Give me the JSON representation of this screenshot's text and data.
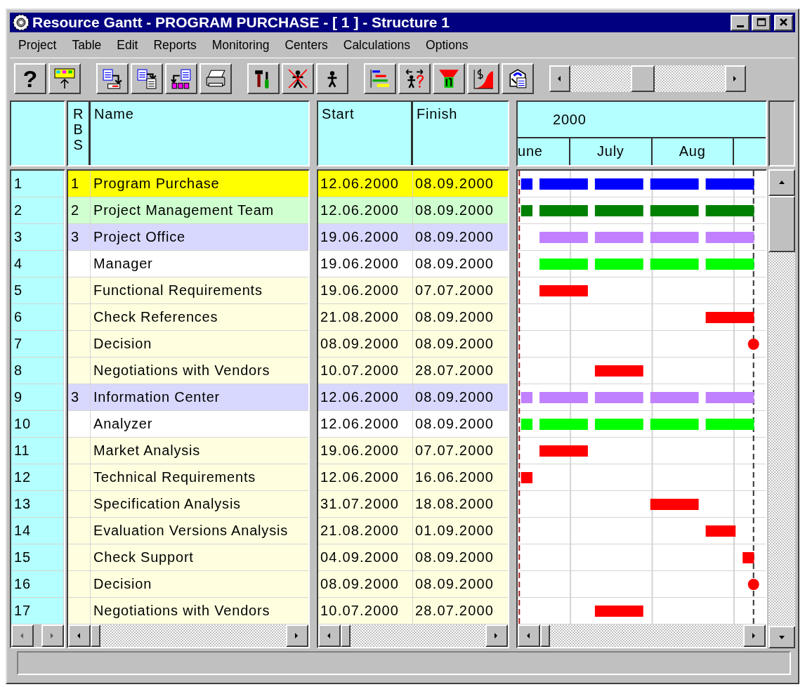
{
  "window": {
    "title": "Resource Gantt - PROGRAM PURCHASE - [ 1 ] - Structure 1"
  },
  "menu": [
    "Project",
    "Table",
    "Edit",
    "Reports",
    "Monitoring",
    "Centers",
    "Calculations",
    "Options"
  ],
  "toolbar": [
    [
      {
        "kind": "help",
        "label": "?"
      },
      {
        "kind": "grid-up"
      }
    ],
    [
      {
        "kind": "doc-out"
      },
      {
        "kind": "doc-in"
      },
      {
        "kind": "return"
      },
      {
        "kind": "print"
      }
    ],
    [
      {
        "kind": "tools"
      },
      {
        "kind": "remove-person"
      },
      {
        "kind": "person"
      }
    ],
    [
      {
        "kind": "chart"
      },
      {
        "kind": "swap-person"
      },
      {
        "kind": "filter"
      },
      {
        "kind": "cost-curve"
      },
      {
        "kind": "export"
      }
    ]
  ],
  "table": {
    "columns": {
      "rbs": "RBS",
      "name": "Name",
      "start": "Start",
      "finish": "Finish"
    },
    "timeline": {
      "year": "2000",
      "months": [
        "une",
        "July",
        "Aug"
      ]
    },
    "rows": [
      {
        "number": "1",
        "rbs": "1",
        "name": "Program Purchase",
        "start": "12.06.2000",
        "finish": "08.09.2000",
        "kind": "project",
        "color": "#0000ff"
      },
      {
        "number": "2",
        "rbs": "2",
        "name": "Project Management Team",
        "start": "12.06.2000",
        "finish": "08.09.2000",
        "kind": "team",
        "color": "#008000"
      },
      {
        "number": "3",
        "rbs": "3",
        "name": "Project Office",
        "start": "19.06.2000",
        "finish": "08.09.2000",
        "kind": "group",
        "color": "#c080ff"
      },
      {
        "number": "4",
        "name": "Manager",
        "start": "19.06.2000",
        "finish": "08.09.2000",
        "kind": "resource",
        "color": "#00ff00"
      },
      {
        "number": "5",
        "name": "Functional Requirements",
        "start": "19.06.2000",
        "finish": "07.07.2000",
        "kind": "task",
        "color": "#ff0000"
      },
      {
        "number": "6",
        "name": "Check References",
        "start": "21.08.2000",
        "finish": "08.09.2000",
        "kind": "task",
        "color": "#ff0000"
      },
      {
        "number": "7",
        "name": "Decision",
        "start": "08.09.2000",
        "finish": "08.09.2000",
        "kind": "task",
        "color": "#ff0000"
      },
      {
        "number": "8",
        "name": "Negotiations with Vendors",
        "start": "10.07.2000",
        "finish": "28.07.2000",
        "kind": "task",
        "color": "#ff0000"
      },
      {
        "number": "9",
        "rbs": "3",
        "name": "Information Center",
        "start": "12.06.2000",
        "finish": "08.09.2000",
        "kind": "group",
        "color": "#c080ff"
      },
      {
        "number": "10",
        "name": "Analyzer",
        "start": "12.06.2000",
        "finish": "08.09.2000",
        "kind": "resource",
        "color": "#00ff00"
      },
      {
        "number": "11",
        "name": "Market Analysis",
        "start": "19.06.2000",
        "finish": "07.07.2000",
        "kind": "task",
        "color": "#ff0000"
      },
      {
        "number": "12",
        "name": "Technical Requirements",
        "start": "12.06.2000",
        "finish": "16.06.2000",
        "kind": "task",
        "color": "#ff0000"
      },
      {
        "number": "13",
        "name": "Specification Analysis",
        "start": "31.07.2000",
        "finish": "18.08.2000",
        "kind": "task",
        "color": "#ff0000"
      },
      {
        "number": "14",
        "name": "Evaluation Versions Analysis",
        "start": "21.08.2000",
        "finish": "01.09.2000",
        "kind": "task",
        "color": "#ff0000"
      },
      {
        "number": "15",
        "name": "Check Support",
        "start": "04.09.2000",
        "finish": "08.09.2000",
        "kind": "task",
        "color": "#ff0000"
      },
      {
        "number": "16",
        "name": "Decision",
        "start": "08.09.2000",
        "finish": "08.09.2000",
        "kind": "task",
        "color": "#ff0000"
      },
      {
        "number": "17",
        "name": "Negotiations with Vendors",
        "start": "10.07.2000",
        "finish": "28.07.2000",
        "kind": "task",
        "color": "#ff0000"
      }
    ]
  }
}
